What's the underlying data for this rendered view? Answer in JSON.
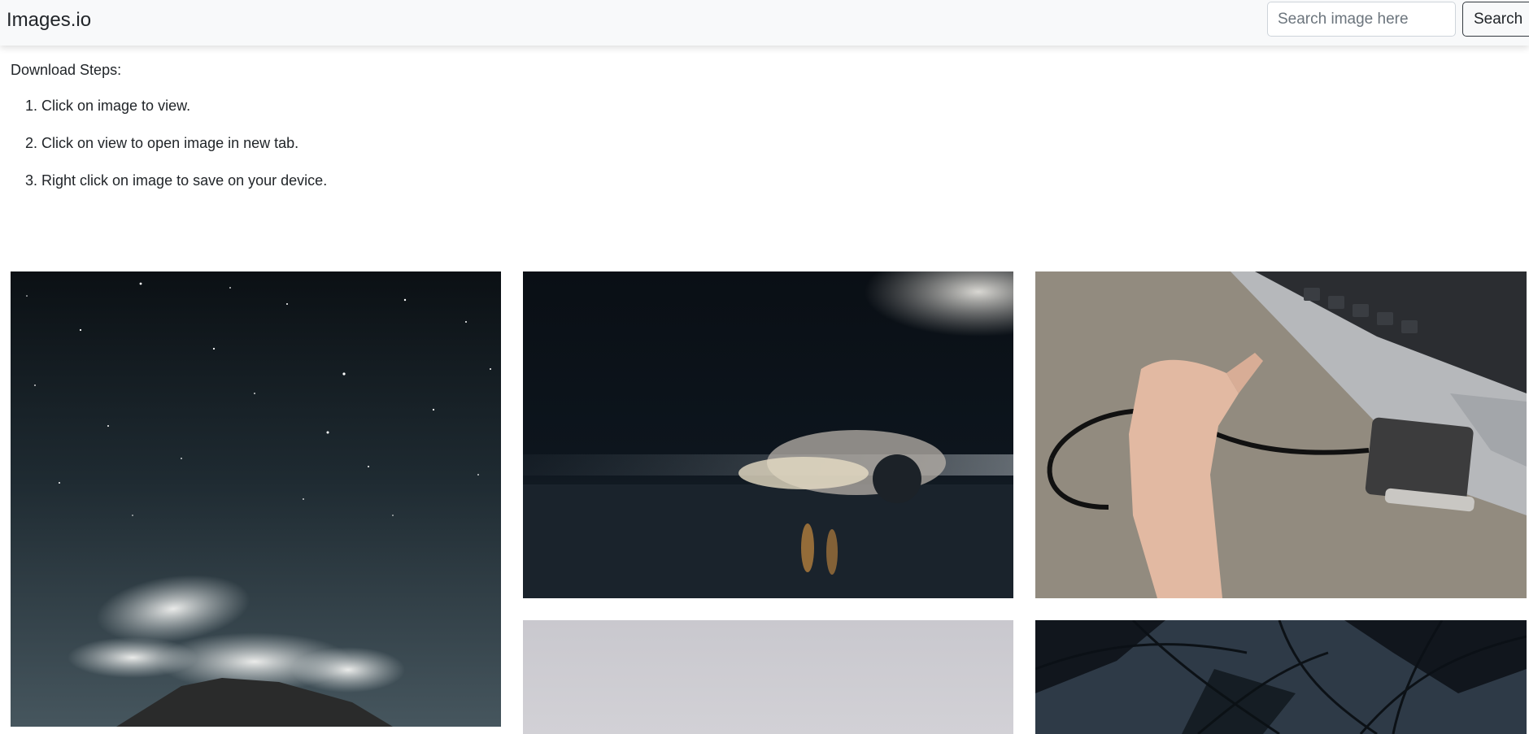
{
  "navbar": {
    "brand": "Images.io",
    "search_placeholder": "Search image here",
    "search_button": "Search"
  },
  "steps": {
    "heading": "Download Steps:",
    "items": [
      "1. Click on image to view.",
      "2. Click on view to open image in new tab.",
      "3. Right click on image to save on your device."
    ]
  },
  "gallery": {
    "images": [
      {
        "subject": "night-sky-mountain"
      },
      {
        "subject": "car-motion-blur"
      },
      {
        "subject": "hand-ssd-laptop"
      },
      {
        "subject": "grey-sky"
      },
      {
        "subject": "palm-leaves"
      }
    ]
  },
  "colors": {
    "navbar_bg": "#f8f9fa",
    "text": "#212529",
    "placeholder": "#6c757d"
  }
}
